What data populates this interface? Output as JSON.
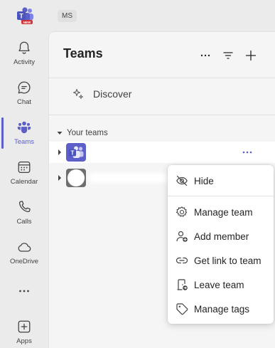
{
  "account": {
    "initials": "MS"
  },
  "app_logo": {
    "badge": "NEW"
  },
  "rail": {
    "items": [
      {
        "label": "Activity",
        "icon": "bell-icon"
      },
      {
        "label": "Chat",
        "icon": "chat-icon"
      },
      {
        "label": "Teams",
        "icon": "teams-icon",
        "active": true
      },
      {
        "label": "Calendar",
        "icon": "calendar-icon"
      },
      {
        "label": "Calls",
        "icon": "phone-icon"
      },
      {
        "label": "OneDrive",
        "icon": "cloud-icon"
      },
      {
        "label": "",
        "icon": "more-horizontal-icon"
      },
      {
        "label": "Apps",
        "icon": "add-apps-icon"
      }
    ]
  },
  "panel": {
    "title": "Teams",
    "header_actions": [
      "more-options-icon",
      "filter-icon",
      "plus-icon"
    ],
    "discover": {
      "label": "Discover",
      "icon": "sparkle-icon"
    },
    "section": {
      "label": "Your teams"
    },
    "teams": [
      {
        "name": "",
        "avatar": "teams-logo-avatar",
        "highlighted": true
      },
      {
        "name": "",
        "avatar": "grey-placeholder-avatar",
        "highlighted": false
      }
    ]
  },
  "context_menu": {
    "items": [
      {
        "label": "Hide",
        "icon": "eye-off-icon"
      },
      {
        "label": "Manage team",
        "icon": "settings-gear-icon"
      },
      {
        "label": "Add member",
        "icon": "person-add-icon"
      },
      {
        "label": "Get link to team",
        "icon": "link-icon"
      },
      {
        "label": "Leave team",
        "icon": "leave-door-icon"
      },
      {
        "label": "Manage tags",
        "icon": "tag-icon"
      }
    ]
  },
  "colors": {
    "accent": "#5b5fc7",
    "rail_bg": "#ebebeb",
    "panel_bg": "#f5f5f5",
    "menu_bg": "#ffffff"
  }
}
